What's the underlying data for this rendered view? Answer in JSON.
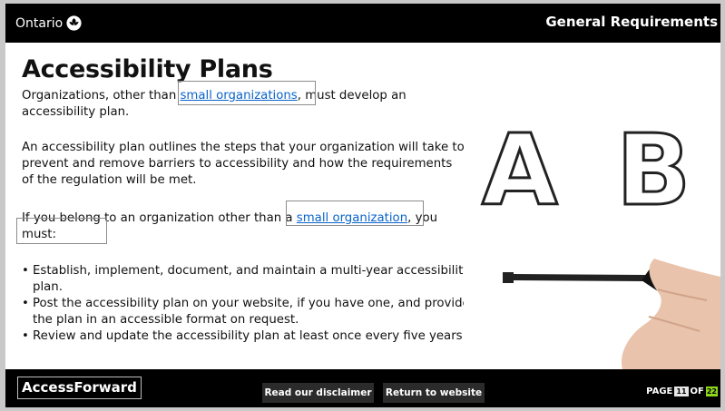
{
  "header": {
    "brand": "Ontario",
    "title": "General Requirements"
  },
  "main": {
    "title": "Accessibility Plans",
    "p1_before": "Organizations, other than ",
    "p1_link": "small organizations",
    "p1_after": ", must develop an accessibility plan.",
    "p2": "An accessibility plan outlines the steps that your organization will take to prevent and remove barriers to accessibility and how the requirements of the regulation will be met.",
    "p3_before": "If you belong to an organization other than a ",
    "p3_link": "small organization",
    "p3_after": ", you must:",
    "list": [
      "Establish, implement, document, and maintain a multi-year accessibility plan.",
      "Post the accessibility plan on your website, if you have one, and provide the plan in an accessible format on request.",
      "Review and update the accessibility plan at least once every five years."
    ],
    "illustration": {
      "letter_a": "A",
      "letter_b": "B"
    }
  },
  "footer": {
    "logo": "AccessForward",
    "disclaimer_button": "Read our disclaimer",
    "return_button": "Return to website",
    "page_label": "PAGE",
    "page_current": "11",
    "page_of": "OF",
    "page_total": "22"
  },
  "colors": {
    "link": "#0a63c9",
    "bar": "#000000",
    "page_total_badge": "#8ed61a"
  }
}
